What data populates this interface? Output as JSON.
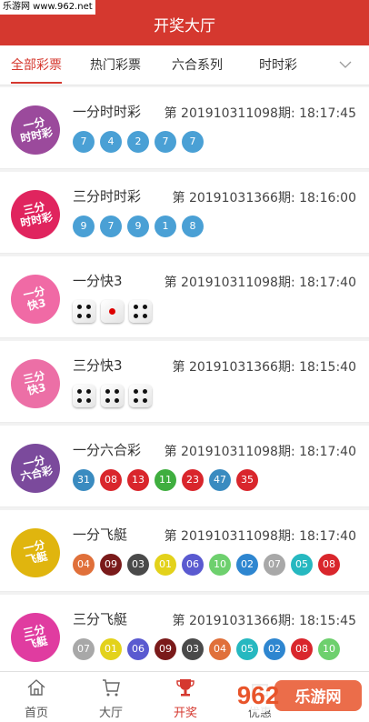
{
  "watermark": "乐游网 www.962.net",
  "header": {
    "title": "开奖大厅"
  },
  "tabs": [
    {
      "label": "全部彩票",
      "active": true
    },
    {
      "label": "热门彩票",
      "active": false
    },
    {
      "label": "六合系列",
      "active": false
    },
    {
      "label": "时时彩",
      "active": false
    }
  ],
  "tabs_more_icon": "chevron-down-icon",
  "colors": {
    "brand_red": "#d5382f",
    "ball_blue": "#4aa0d5"
  },
  "lotteries": [
    {
      "name": "一分时时彩",
      "issue": "第 20191031109​8期: 18:17:45",
      "logo": {
        "text": "一分\n时时彩",
        "color": "#9b4a9c"
      },
      "type": "balls",
      "balls": [
        {
          "n": "7",
          "color": "#4aa0d5"
        },
        {
          "n": "4",
          "color": "#4aa0d5"
        },
        {
          "n": "2",
          "color": "#4aa0d5"
        },
        {
          "n": "7",
          "color": "#4aa0d5"
        },
        {
          "n": "7",
          "color": "#4aa0d5"
        }
      ]
    },
    {
      "name": "三分时时彩",
      "issue": "第 20191031366期: 18:16:00",
      "logo": {
        "text": "三分\n时时彩",
        "color": "#e0245e"
      },
      "type": "balls",
      "balls": [
        {
          "n": "9",
          "color": "#4aa0d5"
        },
        {
          "n": "7",
          "color": "#4aa0d5"
        },
        {
          "n": "9",
          "color": "#4aa0d5"
        },
        {
          "n": "1",
          "color": "#4aa0d5"
        },
        {
          "n": "8",
          "color": "#4aa0d5"
        }
      ]
    },
    {
      "name": "一分快3",
      "issue": "第 20191031109​8期: 18:17:40",
      "logo": {
        "text": "一分\n快3",
        "color": "#f06aa5"
      },
      "type": "dice",
      "dice": [
        4,
        1,
        4
      ]
    },
    {
      "name": "三分快3",
      "issue": "第 20191031366期: 18:15:40",
      "logo": {
        "text": "三分\n快3",
        "color": "#ec6fa6"
      },
      "type": "dice",
      "dice": [
        4,
        4,
        4
      ]
    },
    {
      "name": "一分六合彩",
      "issue": "第 20191031109​8期: 18:17:40",
      "logo": {
        "text": "一分\n六合彩",
        "color": "#7b4a9c"
      },
      "type": "balls",
      "balls": [
        {
          "n": "31",
          "color": "#3a8bc0"
        },
        {
          "n": "08",
          "color": "#d9262c"
        },
        {
          "n": "13",
          "color": "#d9262c"
        },
        {
          "n": "11",
          "color": "#3fae3f"
        },
        {
          "n": "23",
          "color": "#d9262c"
        },
        {
          "n": "47",
          "color": "#3a8bc0"
        },
        {
          "n": "35",
          "color": "#d9262c"
        }
      ]
    },
    {
      "name": "一分飞艇",
      "issue": "第 20191031109​8期: 18:17:40",
      "logo": {
        "text": "一分\n飞艇",
        "color": "#e0b50e"
      },
      "type": "balls",
      "balls": [
        {
          "n": "04",
          "color": "#e0703a"
        },
        {
          "n": "09",
          "color": "#7a1a1a"
        },
        {
          "n": "03",
          "color": "#4a4a4a"
        },
        {
          "n": "01",
          "color": "#e3d21b"
        },
        {
          "n": "06",
          "color": "#5a5ad0"
        },
        {
          "n": "10",
          "color": "#6ed06e"
        },
        {
          "n": "02",
          "color": "#2e86d0"
        },
        {
          "n": "07",
          "color": "#a8a8a8"
        },
        {
          "n": "05",
          "color": "#26b8c0"
        },
        {
          "n": "08",
          "color": "#d9262c"
        }
      ]
    },
    {
      "name": "三分飞艇",
      "issue": "第 20191031366期: 18:15:45",
      "logo": {
        "text": "三分\n飞艇",
        "color": "#e03ca0"
      },
      "type": "balls",
      "balls": [
        {
          "n": "07",
          "color": "#a8a8a8"
        },
        {
          "n": "01",
          "color": "#e3d21b"
        },
        {
          "n": "06",
          "color": "#5a5ad0"
        },
        {
          "n": "09",
          "color": "#7a1a1a"
        },
        {
          "n": "03",
          "color": "#4a4a4a"
        },
        {
          "n": "04",
          "color": "#e0703a"
        },
        {
          "n": "05",
          "color": "#26b8c0"
        },
        {
          "n": "02",
          "color": "#2e86d0"
        },
        {
          "n": "08",
          "color": "#d9262c"
        },
        {
          "n": "10",
          "color": "#6ed06e"
        }
      ]
    }
  ],
  "tabbar": [
    {
      "label": "首页",
      "icon": "home-icon",
      "active": false
    },
    {
      "label": "大厅",
      "icon": "cart-icon",
      "active": false
    },
    {
      "label": "开奖",
      "icon": "trophy-icon",
      "active": true
    },
    {
      "label": "优惠",
      "icon": "gift-icon",
      "active": false
    }
  ],
  "brand_logo": {
    "main": "962",
    "sub": "乐游网"
  }
}
